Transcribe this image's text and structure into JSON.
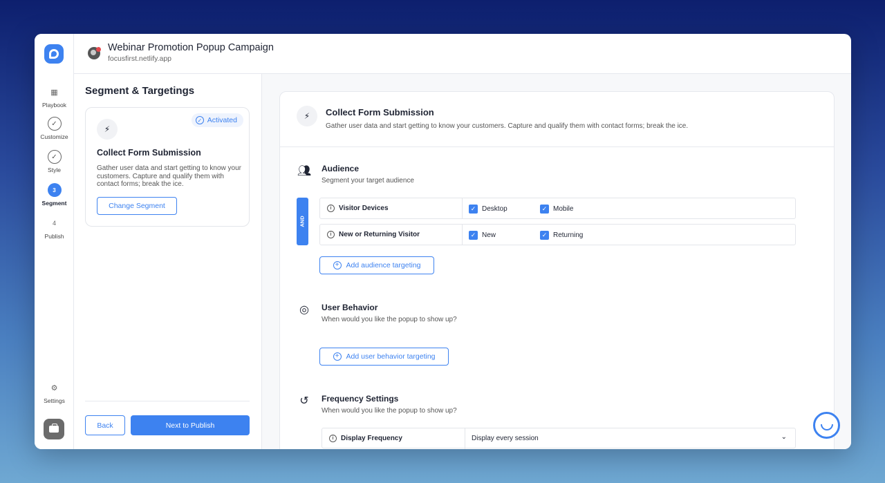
{
  "header": {
    "title": "Webinar Promotion Popup Campaign",
    "subtitle": "focusfirst.netlify.app"
  },
  "rail": {
    "items": [
      {
        "label": "Playbook",
        "icon": "grid-icon"
      },
      {
        "label": "Customize",
        "icon": "check-icon"
      },
      {
        "label": "Style",
        "icon": "check-icon"
      },
      {
        "label": "Segment",
        "step": "3",
        "active": true
      },
      {
        "label": "Publish",
        "step": "4"
      }
    ],
    "settings_label": "Settings"
  },
  "segment_panel": {
    "title": "Segment & Targetings",
    "card": {
      "badge": "Activated",
      "name": "Collect Form Submission",
      "description": "Gather user data and start getting to know your customers. Capture and qualify them with contact forms; break the ice.",
      "change_button": "Change Segment"
    },
    "back_button": "Back",
    "next_button": "Next to Publish"
  },
  "main": {
    "title": "Collect Form Submission",
    "subtitle": "Gather user data and start getting to know your customers. Capture and qualify them with contact forms; break the ice.",
    "audience": {
      "title": "Audience",
      "subtitle": "Segment your target audience",
      "operator": "AND",
      "rows": [
        {
          "label": "Visitor Devices",
          "options": [
            "Desktop",
            "Mobile"
          ]
        },
        {
          "label": "New or Returning Visitor",
          "options": [
            "New",
            "Returning"
          ]
        }
      ],
      "add_button": "Add audience targeting"
    },
    "behavior": {
      "title": "User Behavior",
      "subtitle": "When would you like the popup to show up?",
      "add_button": "Add user behavior targeting"
    },
    "frequency": {
      "title": "Frequency Settings",
      "subtitle": "When would you like the popup to show up?",
      "row_label": "Display Frequency",
      "row_value": "Display every session"
    }
  },
  "colors": {
    "accent": "#3d82f0"
  }
}
